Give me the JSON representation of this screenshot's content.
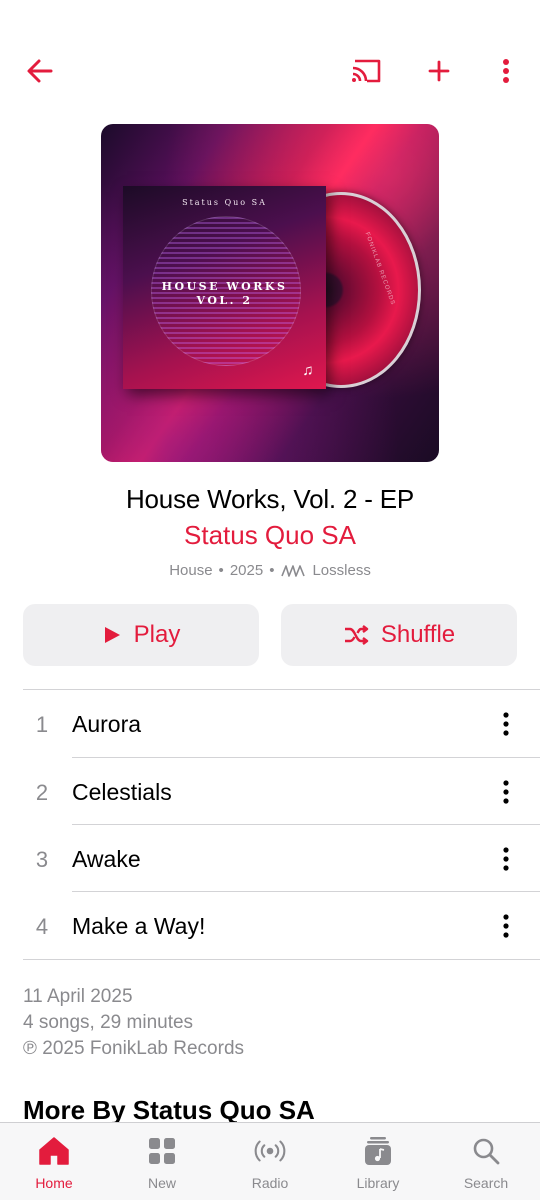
{
  "colors": {
    "accent": "#e31c3d",
    "secondary_text": "#8a8a8e",
    "button_bg": "#efeff1"
  },
  "topbar": {
    "back_icon": "back-arrow-icon",
    "cast_icon": "airplay-cast-icon",
    "add_icon": "plus-icon",
    "more_icon": "vertical-ellipsis-icon"
  },
  "artwork": {
    "sleeve_artist": "Status Quo SA",
    "sleeve_title_line1": "House Works",
    "sleeve_title_line2": "Vol. 2",
    "cd_label": "FONIKLAB RECORDS"
  },
  "album": {
    "title": "House Works, Vol. 2 - EP",
    "artist": "Status Quo SA",
    "genre": "House",
    "separator": "•",
    "year": "2025",
    "quality": "Lossless"
  },
  "actions": {
    "play_label": "Play",
    "shuffle_label": "Shuffle"
  },
  "tracks": [
    {
      "number": "1",
      "title": "Aurora"
    },
    {
      "number": "2",
      "title": "Celestials"
    },
    {
      "number": "3",
      "title": "Awake"
    },
    {
      "number": "4",
      "title": "Make a Way!"
    }
  ],
  "info": {
    "release_date": "11 April 2025",
    "summary": "4 songs, 29 minutes",
    "copyright": "℗ 2025 FonikLab Records"
  },
  "more_by_heading": "More By Status Quo SA",
  "tabs": [
    {
      "label": "Home",
      "icon": "home-icon",
      "active": true
    },
    {
      "label": "New",
      "icon": "grid-icon",
      "active": false
    },
    {
      "label": "Radio",
      "icon": "radio-broadcast-icon",
      "active": false
    },
    {
      "label": "Library",
      "icon": "music-library-icon",
      "active": false
    },
    {
      "label": "Search",
      "icon": "search-icon",
      "active": false
    }
  ]
}
